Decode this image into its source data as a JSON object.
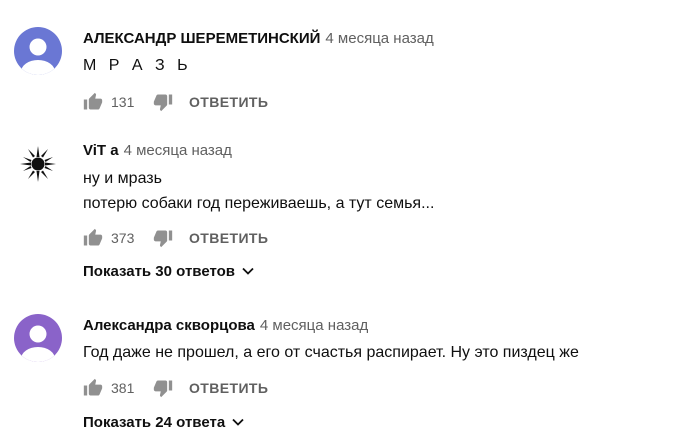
{
  "colors": {
    "text_primary": "#0f0f0f",
    "text_secondary": "#606060",
    "avatar_blue": "#6a77d4",
    "avatar_purple": "#8a63c9",
    "icon_gray": "#909090"
  },
  "comments": [
    {
      "author": "АЛЕКСАНДР ШЕРЕМЕТИНСКИЙ",
      "time": "4 месяца назад",
      "lines": [
        "М Р А З Ь"
      ],
      "likes": "131",
      "reply_label": "ОТВЕТИТЬ",
      "avatar_icon": "default-user-icon"
    },
    {
      "author": "ViT a",
      "time": "4 месяца назад",
      "lines": [
        "ну и мразь",
        "потерю собаки год переживаешь, а тут семья..."
      ],
      "likes": "373",
      "reply_label": "ОТВЕТИТЬ",
      "avatar_icon": "sun-symbol-icon",
      "show_replies": "Показать 30 ответов"
    },
    {
      "author": "Александра скворцова",
      "time": "4 месяца назад",
      "lines": [
        "Год даже не прошел, а его от счастья распирает. Ну это пиздец же"
      ],
      "likes": "381",
      "reply_label": "ОТВЕТИТЬ",
      "avatar_icon": "default-user-icon",
      "show_replies": "Показать 24 ответа"
    }
  ]
}
